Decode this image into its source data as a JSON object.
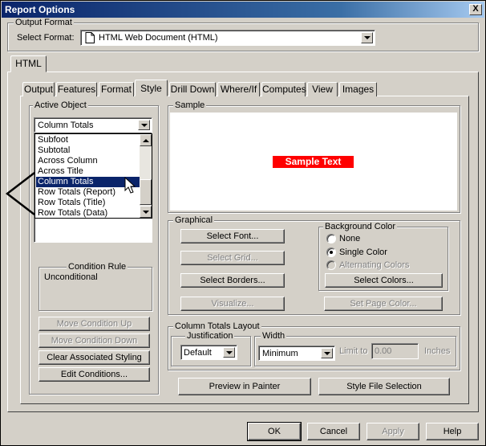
{
  "window": {
    "title": "Report Options",
    "close_label": "X"
  },
  "output_format": {
    "group_label": "Output Format",
    "select_label": "Select Format:",
    "selected": "HTML Web Document (HTML)",
    "icon": "document-icon"
  },
  "top_tab": {
    "label": "HTML"
  },
  "tabs": [
    {
      "label": "Output",
      "active": false
    },
    {
      "label": "Features",
      "active": false
    },
    {
      "label": "Format",
      "active": false
    },
    {
      "label": "Style",
      "active": true
    },
    {
      "label": "Drill Down",
      "active": false
    },
    {
      "label": "Where/If",
      "active": false
    },
    {
      "label": "Computes",
      "active": false
    },
    {
      "label": "View",
      "active": false
    },
    {
      "label": "Images",
      "active": false
    }
  ],
  "active_object": {
    "group_label": "Active Object",
    "selected": "Column Totals",
    "dropdown_items": [
      {
        "label": "Subfoot",
        "selected": false
      },
      {
        "label": "Subtotal",
        "selected": false
      },
      {
        "label": "Across Column",
        "selected": false
      },
      {
        "label": "Across Title",
        "selected": false
      },
      {
        "label": "Column Totals",
        "selected": true
      },
      {
        "label": "Row Totals (Report)",
        "selected": false
      },
      {
        "label": "Row Totals (Title)",
        "selected": false
      },
      {
        "label": "Row Totals (Data)",
        "selected": false
      }
    ]
  },
  "condition_rule": {
    "group_label": "Condition Rule",
    "value": "Unconditional"
  },
  "condition_buttons": {
    "move_up": "Move Condition Up",
    "move_down": "Move Condition Down",
    "clear_styling": "Clear Associated Styling",
    "edit_conditions": "Edit Conditions..."
  },
  "sample": {
    "group_label": "Sample",
    "text": "Sample Text",
    "text_color": "#ffffff",
    "bg_color": "#ff0000"
  },
  "graphical": {
    "group_label": "Graphical",
    "select_font": "Select Font...",
    "select_grid": "Select Grid...",
    "select_borders": "Select Borders...",
    "visualize": "Visualize...",
    "set_page_color": "Set Page Color..."
  },
  "background_color": {
    "group_label": "Background Color",
    "options": [
      {
        "label": "None",
        "checked": false,
        "disabled": false
      },
      {
        "label": "Single Color",
        "checked": true,
        "disabled": false
      },
      {
        "label": "Alternating Colors",
        "checked": false,
        "disabled": true
      }
    ],
    "select_colors": "Select Colors..."
  },
  "layout": {
    "group_label": "Column Totals Layout",
    "justification_label": "Justification",
    "justification_value": "Default",
    "width_label": "Width",
    "width_value": "Minimum",
    "limit_label": "Limit to",
    "limit_value": "0.00",
    "unit_label": "Inches"
  },
  "bottom_buttons": {
    "preview": "Preview in Painter",
    "style_file": "Style File Selection"
  },
  "dialog_buttons": {
    "ok": "OK",
    "cancel": "Cancel",
    "apply": "Apply",
    "help": "Help"
  }
}
